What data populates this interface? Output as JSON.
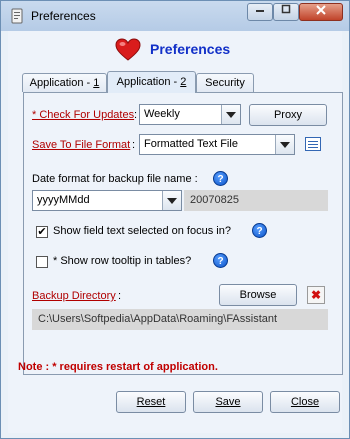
{
  "window": {
    "title": "Preferences"
  },
  "header": {
    "title": "Preferences"
  },
  "tabs": [
    {
      "label": "Application - ",
      "key": "1"
    },
    {
      "label": "Application - ",
      "key": "2"
    },
    {
      "label": "Security"
    }
  ],
  "check_updates": {
    "label": "* Check For Updates",
    "suffix": ":",
    "value": "Weekly",
    "proxy_label": "Proxy"
  },
  "save_format": {
    "label": "Save To File Format",
    "suffix": ":",
    "value": "Formatted Text File"
  },
  "date_format": {
    "label": "Date format for backup file name :",
    "pattern": "yyyyMMdd",
    "preview": "20070825"
  },
  "show_field_text": {
    "label": "Show field text selected on focus in?",
    "checked": true,
    "mark": "✔"
  },
  "show_row_tooltip": {
    "label": "* Show row tooltip in tables?",
    "checked": false
  },
  "backup": {
    "label": "Backup Directory",
    "suffix": ":",
    "browse_label": "Browse",
    "path": "C:\\Users\\Softpedia\\AppData\\Roaming\\FAssistant",
    "clear_mark": "✖"
  },
  "note": {
    "text": "Note : * requires restart of application."
  },
  "footer": {
    "reset_label": "Reset",
    "save_label": "Save",
    "close_label": "Close"
  },
  "help_mark": "?",
  "colors": {
    "accent": "#1230c8",
    "warning": "#c00000",
    "help": "#0a52c8"
  }
}
